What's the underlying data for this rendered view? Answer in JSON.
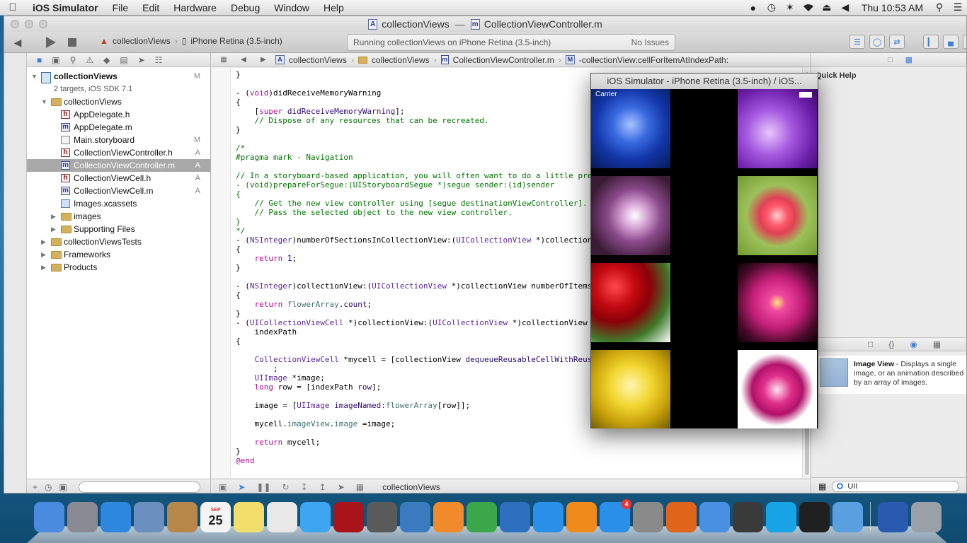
{
  "menubar": {
    "app_name": "iOS Simulator",
    "items": [
      "File",
      "Edit",
      "Hardware",
      "Debug",
      "Window",
      "Help"
    ],
    "clock": "Thu 10:53 AM"
  },
  "xcode": {
    "title_project": "collectionViews",
    "title_separator": "—",
    "title_file": "CollectionViewController.m",
    "scheme_project": "collectionViews",
    "scheme_device": "iPhone Retina (3.5-inch)",
    "activity_status": "Running collectionViews on iPhone Retina (3.5-inch)",
    "activity_issues": "No Issues",
    "jumpbar": [
      "collectionViews",
      "collectionViews",
      "CollectionViewController.m",
      "-collectionView:cellForItemAtIndexPath:"
    ],
    "debug_label": "collectionViews"
  },
  "navigator": {
    "project": {
      "name": "collectionViews",
      "subtitle": "2 targets, iOS SDK 7.1",
      "badge": "M"
    },
    "items": [
      {
        "label": "collectionViews",
        "type": "folder",
        "indent": 1,
        "disclosure": "open",
        "badge": ""
      },
      {
        "label": "AppDelegate.h",
        "type": "h",
        "indent": 2,
        "disclosure": "",
        "badge": ""
      },
      {
        "label": "AppDelegate.m",
        "type": "m",
        "indent": 2,
        "disclosure": "",
        "badge": ""
      },
      {
        "label": "Main.storyboard",
        "type": "storyboard",
        "indent": 2,
        "disclosure": "",
        "badge": "M"
      },
      {
        "label": "CollectionViewController.h",
        "type": "h",
        "indent": 2,
        "disclosure": "",
        "badge": "A"
      },
      {
        "label": "CollectionViewController.m",
        "type": "m",
        "indent": 2,
        "disclosure": "",
        "badge": "A",
        "selected": true
      },
      {
        "label": "CollectionViewCell.h",
        "type": "h",
        "indent": 2,
        "disclosure": "",
        "badge": "A"
      },
      {
        "label": "CollectionViewCell.m",
        "type": "m",
        "indent": 2,
        "disclosure": "",
        "badge": "A"
      },
      {
        "label": "Images.xcassets",
        "type": "assets",
        "indent": 2,
        "disclosure": "",
        "badge": ""
      },
      {
        "label": "images",
        "type": "folder",
        "indent": 2,
        "disclosure": "closed",
        "badge": ""
      },
      {
        "label": "Supporting Files",
        "type": "folder",
        "indent": 2,
        "disclosure": "closed",
        "badge": ""
      },
      {
        "label": "collectionViewsTests",
        "type": "folder",
        "indent": 1,
        "disclosure": "closed",
        "badge": ""
      },
      {
        "label": "Frameworks",
        "type": "folder",
        "indent": 1,
        "disclosure": "closed",
        "badge": ""
      },
      {
        "label": "Products",
        "type": "folder",
        "indent": 1,
        "disclosure": "closed",
        "badge": ""
      }
    ]
  },
  "code_lines": [
    [
      [
        "t",
        "}"
      ]
    ],
    [],
    [
      [
        "t",
        "- ("
      ],
      [
        "kw",
        "void"
      ],
      [
        "t",
        ")didReceiveMemoryWarning"
      ]
    ],
    [
      [
        "t",
        "{"
      ]
    ],
    [
      [
        "t",
        "    ["
      ],
      [
        "kw",
        "super"
      ],
      [
        "t",
        " "
      ],
      [
        "mth",
        "didReceiveMemoryWarning"
      ],
      [
        "t",
        "];"
      ]
    ],
    [
      [
        "cm",
        "    // Dispose of any resources that can be recreated."
      ]
    ],
    [
      [
        "t",
        "}"
      ]
    ],
    [],
    [
      [
        "cm",
        "/*"
      ]
    ],
    [
      [
        "cm",
        "#pragma mark - Navigation"
      ]
    ],
    [],
    [
      [
        "cm",
        "// In a storyboard-based application, you will often want to do a little pre"
      ]
    ],
    [
      [
        "cm",
        "- (void)prepareForSegue:(UIStoryboardSegue *)segue sender:(id)sender"
      ]
    ],
    [
      [
        "cm",
        "{"
      ]
    ],
    [
      [
        "cm",
        "    // Get the new view controller using [segue destinationViewController]."
      ]
    ],
    [
      [
        "cm",
        "    // Pass the selected object to the new view controller."
      ]
    ],
    [
      [
        "cm",
        "}"
      ]
    ],
    [
      [
        "cm",
        "*/"
      ]
    ],
    [
      [
        "t",
        "- ("
      ],
      [
        "cls",
        "NSInteger"
      ],
      [
        "t",
        ")numberOfSectionsInCollectionView:("
      ],
      [
        "cls",
        "UICollectionView"
      ],
      [
        "t",
        " *)collection"
      ]
    ],
    [
      [
        "t",
        "{"
      ]
    ],
    [
      [
        "t",
        "    "
      ],
      [
        "kw",
        "return"
      ],
      [
        "t",
        " "
      ],
      [
        "num",
        "1"
      ],
      [
        "t",
        ";"
      ]
    ],
    [
      [
        "t",
        "}"
      ]
    ],
    [],
    [
      [
        "t",
        "- ("
      ],
      [
        "cls",
        "NSInteger"
      ],
      [
        "t",
        ")collectionView:("
      ],
      [
        "cls",
        "UICollectionView"
      ],
      [
        "t",
        " *)collectionView numberOfItems"
      ]
    ],
    [
      [
        "t",
        "{"
      ]
    ],
    [
      [
        "t",
        "    "
      ],
      [
        "kw",
        "return"
      ],
      [
        "t",
        " "
      ],
      [
        "prop",
        "flowerArray"
      ],
      [
        "t",
        "."
      ],
      [
        "mth",
        "count"
      ],
      [
        "t",
        ";"
      ]
    ],
    [
      [
        "t",
        "}"
      ]
    ],
    [
      [
        "t",
        "- ("
      ],
      [
        "cls",
        "UICollectionViewCell"
      ],
      [
        "t",
        " *)collectionView:("
      ],
      [
        "cls",
        "UICollectionView"
      ],
      [
        "t",
        " *)collectionView"
      ]
    ],
    [
      [
        "t",
        "    indexPath"
      ]
    ],
    [
      [
        "t",
        "{"
      ]
    ],
    [],
    [
      [
        "t",
        "    "
      ],
      [
        "cls",
        "CollectionViewCell"
      ],
      [
        "t",
        " *mycell = [collectionView "
      ],
      [
        "mth",
        "dequeueReusableCellWithReus"
      ]
    ],
    [
      [
        "t",
        "        ;"
      ]
    ],
    [
      [
        "t",
        "    "
      ],
      [
        "cls",
        "UIImage"
      ],
      [
        "t",
        " *image;"
      ]
    ],
    [
      [
        "t",
        "    "
      ],
      [
        "kw",
        "long"
      ],
      [
        "t",
        " row = [indexPath "
      ],
      [
        "mth",
        "row"
      ],
      [
        "t",
        "];"
      ]
    ],
    [],
    [
      [
        "t",
        "    image = ["
      ],
      [
        "cls",
        "UIImage"
      ],
      [
        "t",
        " "
      ],
      [
        "mth",
        "imageNamed:"
      ],
      [
        "prop",
        "flowerArray"
      ],
      [
        "t",
        "[row]];"
      ]
    ],
    [],
    [
      [
        "t",
        "    mycell."
      ],
      [
        "prop",
        "imageView"
      ],
      [
        "t",
        "."
      ],
      [
        "prop",
        "image"
      ],
      [
        "t",
        " =image;"
      ]
    ],
    [],
    [
      [
        "t",
        "    "
      ],
      [
        "kw",
        "return"
      ],
      [
        "t",
        " mycell;"
      ]
    ],
    [
      [
        "t",
        "}"
      ]
    ],
    [
      [
        "kw",
        "@end"
      ]
    ]
  ],
  "utilities": {
    "quick_help_title": "Quick Help",
    "library_item_title": "Image View",
    "library_item_desc": " - Displays a single image, or an animation described by an array of images.",
    "library_search": "UII"
  },
  "simulator": {
    "title": "iOS Simulator - iPhone Retina (3.5-inch) / iOS...",
    "carrier": "Carrier"
  },
  "dock": {
    "app_store_badge": "4",
    "apps": [
      "finder-icon",
      "launchpad-icon",
      "safari-icon",
      "mail-icon",
      "contacts-icon",
      "calendar-icon",
      "notes-icon",
      "reminders-icon",
      "messages-icon",
      "photo-booth-icon",
      "facetime-icon",
      "iphoto-icon",
      "pages-icon",
      "numbers-icon",
      "keynote-icon",
      "itunes-icon",
      "ibooks-icon",
      "app-store-icon",
      "system-preferences-icon",
      "firefox-icon",
      "xcode-icon",
      "ios-simulator-icon",
      "skype-icon",
      "terminal-icon",
      "instruments-icon",
      "downloads-stack-icon",
      "trash-icon"
    ],
    "calendar_month": "SEP",
    "calendar_day": "25"
  }
}
